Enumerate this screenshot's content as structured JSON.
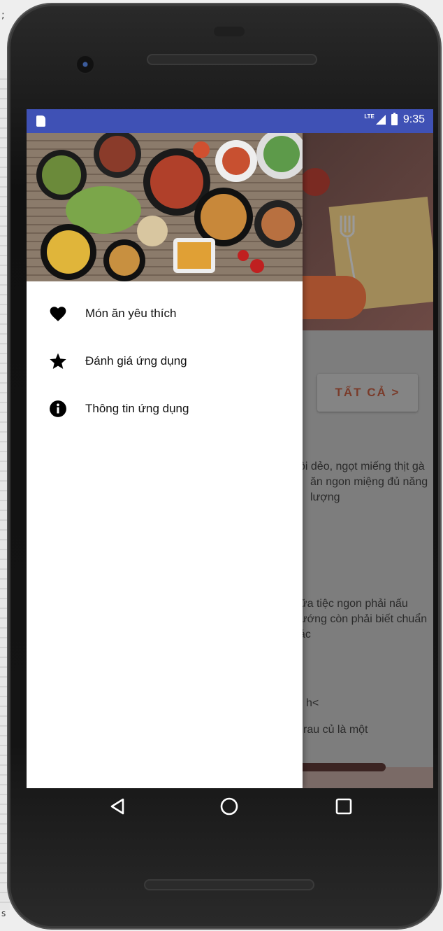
{
  "app": {
    "stray_top_text": ";",
    "stray_bottom_text": "s",
    "status_bar": {
      "time": "9:35",
      "network": "LTE"
    },
    "background": {
      "see_all_button": "TẤT CẢ >",
      "snippets": [
        "xôi dẻo, ngọt miếng thịt gà ăn ngon miệng đủ năng lượng",
        "bữa tiệc ngon phải nấu nướng còn phải biết chuẩn xác",
        "h<",
        "rau củ là một"
      ]
    },
    "drawer": {
      "items": [
        {
          "label": "Món ăn yêu thích",
          "icon": "heart-icon"
        },
        {
          "label": "Đánh giá ứng dụng",
          "icon": "star-icon"
        },
        {
          "label": "Thông tin ứng dụng",
          "icon": "info-icon"
        }
      ]
    },
    "nav": {
      "back": "back-icon",
      "home": "home-icon",
      "recents": "recents-icon"
    },
    "colors": {
      "status_bar": "#3f51b5",
      "accent": "#c8502b",
      "drawer_bg": "#ffffff"
    }
  }
}
